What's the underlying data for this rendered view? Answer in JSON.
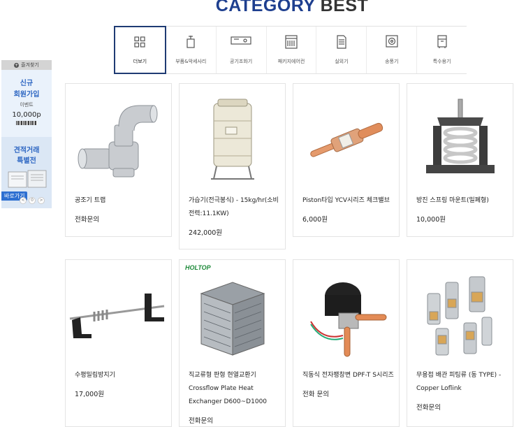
{
  "header": {
    "title_accent": "CATEGORY",
    "title_rest": "BEST"
  },
  "tabs": [
    {
      "label": "더보기",
      "icon": "grid-icon",
      "active": true
    },
    {
      "label": "부품&악세사리",
      "icon": "valve-icon",
      "active": false
    },
    {
      "label": "공기조화기",
      "icon": "air-handler-icon",
      "active": false
    },
    {
      "label": "패키지에어컨",
      "icon": "package-ac-icon",
      "active": false
    },
    {
      "label": "실외기",
      "icon": "outdoor-unit-icon",
      "active": false
    },
    {
      "label": "송풍기",
      "icon": "fan-icon",
      "active": false
    },
    {
      "label": "특수용기",
      "icon": "special-unit-icon",
      "active": false
    }
  ],
  "sidebar": {
    "favorite_label": "즐겨찾기",
    "promo1_line1": "신규",
    "promo1_line2": "회원가입",
    "promo1_line3": "이벤트",
    "promo1_amount": "10,000p",
    "promo2_line1": "견적거래",
    "promo2_line2": "특별전",
    "go_label": "바로가기",
    "pager_prev": "<",
    "pager_page": "0",
    "pager_next": ">"
  },
  "products": [
    {
      "name": "공조기 트랩",
      "price": "전화문의",
      "image": "pvc-trap"
    },
    {
      "name": "가습기(전극봉식) - 15kg/hr(소비전력:11.1KW)",
      "price": "242,000원",
      "image": "humidifier"
    },
    {
      "name": "Piston타입 YCV시리즈 체크밸브",
      "price": "6,000원",
      "image": "check-valve"
    },
    {
      "name": "방진 스프링 마운트(밀폐형)",
      "price": "10,000원",
      "image": "spring-mount"
    },
    {
      "name": "수평밀림방지기",
      "price": "17,000원",
      "image": "anti-slide"
    },
    {
      "name": "직교류형 판형 현열교환기 Crossflow Plate Heat Exchanger D600~D1000",
      "price": "전화문의",
      "image": "heat-exchanger",
      "brand": "HOLTOP"
    },
    {
      "name": "직동식 전자팽창변 DPF-T S시리즈",
      "price": "전화 문의",
      "image": "expansion-valve"
    },
    {
      "name": "무용접 배관 피팅류 (동 TYPE) - Copper Loflink",
      "price": "전화문의",
      "image": "pipe-fittings"
    }
  ],
  "colors": {
    "accent": "#1e3f8f",
    "tab_border": "#1f3b73",
    "promo_blue": "#2d66c2"
  }
}
